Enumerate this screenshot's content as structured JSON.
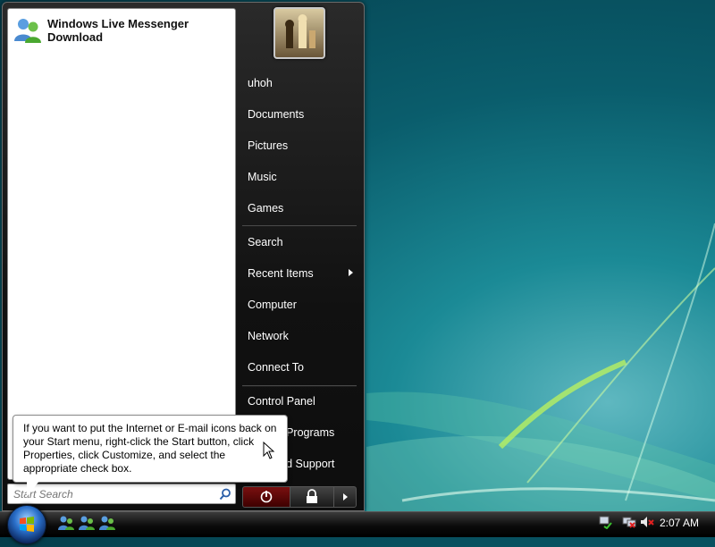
{
  "start_menu": {
    "pinned": [
      {
        "label": "Windows Live Messenger Download",
        "icon": "messenger-icon"
      }
    ],
    "search_placeholder": "Start Search",
    "right_items": [
      {
        "label": "uhoh"
      },
      {
        "label": "Documents"
      },
      {
        "label": "Pictures"
      },
      {
        "label": "Music"
      },
      {
        "label": "Games"
      },
      {
        "label": "Search"
      },
      {
        "label": "Recent Items",
        "submenu": true
      },
      {
        "label": "Computer"
      },
      {
        "label": "Network"
      },
      {
        "label": "Connect To"
      },
      {
        "label": "Control Panel"
      },
      {
        "label": "Default Programs"
      },
      {
        "label": "Help and Support"
      }
    ]
  },
  "tooltip": {
    "text": "If you want to put the Internet or E-mail icons back on your Start menu, right-click the Start button, click Properties, click Customize, and select the appropriate check box."
  },
  "taskbar": {
    "clock": "2:07 AM",
    "quick_launch": [
      "messenger-icon",
      "messenger-icon",
      "messenger-icon"
    ],
    "tray_icons": [
      "network-icon",
      "network-disconnected-icon",
      "volume-muted-icon"
    ]
  },
  "colors": {
    "accent": "#2a6fc9",
    "desktop": "#0a5d6c"
  }
}
